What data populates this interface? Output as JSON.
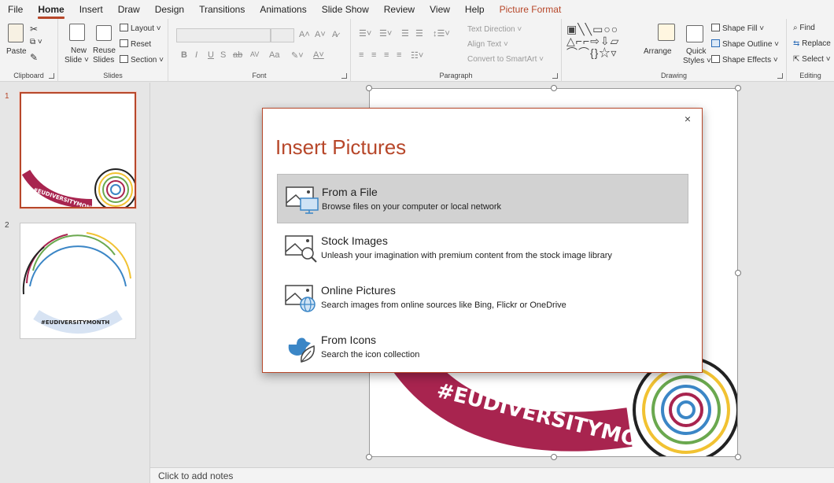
{
  "menu": {
    "tabs": [
      "File",
      "Home",
      "Insert",
      "Draw",
      "Design",
      "Transitions",
      "Animations",
      "Slide Show",
      "Review",
      "View",
      "Help",
      "Picture Format"
    ],
    "active": "Home"
  },
  "ribbon": {
    "clipboard": {
      "paste": "Paste",
      "label": "Clipboard"
    },
    "slides": {
      "new_slide": "New",
      "new_slide2": "Slide ˅",
      "reuse": "Reuse",
      "reuse2": "Slides",
      "layout": "Layout ˅",
      "reset": "Reset",
      "section": "Section ˅",
      "label": "Slides"
    },
    "font": {
      "label": "Font",
      "bold": "B",
      "italic": "I",
      "underline": "U",
      "strike": "S",
      "spacing": "AV",
      "case": "Aa",
      "grow": "A˄",
      "shrink": "A˅"
    },
    "paragraph": {
      "text_direction": "Text Direction ˅",
      "align_text": "Align Text ˅",
      "smartart": "Convert to SmartArt ˅",
      "label": "Paragraph"
    },
    "drawing": {
      "arrange": "Arrange",
      "quick_styles": "Quick",
      "quick_styles2": "Styles ˅",
      "shape_fill": "Shape Fill ˅",
      "shape_outline": "Shape Outline ˅",
      "shape_effects": "Shape Effects ˅",
      "label": "Drawing"
    },
    "editing": {
      "find": "Find",
      "replace": "Replace",
      "select": "Select ˅",
      "label": "Editing"
    }
  },
  "slides_panel": {
    "items": [
      {
        "number": "1",
        "caption": "#EUDIVERSITYMONTH"
      },
      {
        "number": "2",
        "caption": "#EUDIVERSITYMONTH"
      }
    ]
  },
  "canvas": {
    "banner_text": "#EUDIVERSITYMONTH"
  },
  "notes": {
    "placeholder": "Click to add notes"
  },
  "dialog": {
    "title": "Insert Pictures",
    "close": "×",
    "options": [
      {
        "title": "From a File",
        "desc": "Browse files on your computer or local network",
        "icon": "picture-monitor-icon"
      },
      {
        "title": "Stock Images",
        "desc": "Unleash your imagination with premium content from the stock image library",
        "icon": "picture-search-icon"
      },
      {
        "title": "Online Pictures",
        "desc": "Search images from online sources like Bing, Flickr or OneDrive",
        "icon": "picture-globe-icon"
      },
      {
        "title": "From Icons",
        "desc": "Search the icon collection",
        "icon": "icons-bird-leaf-icon"
      }
    ]
  },
  "colors": {
    "accent": "#b7472a",
    "banner": "#a8244f",
    "hover": "#d2d2d2",
    "icon_blue": "#3b86c6"
  }
}
